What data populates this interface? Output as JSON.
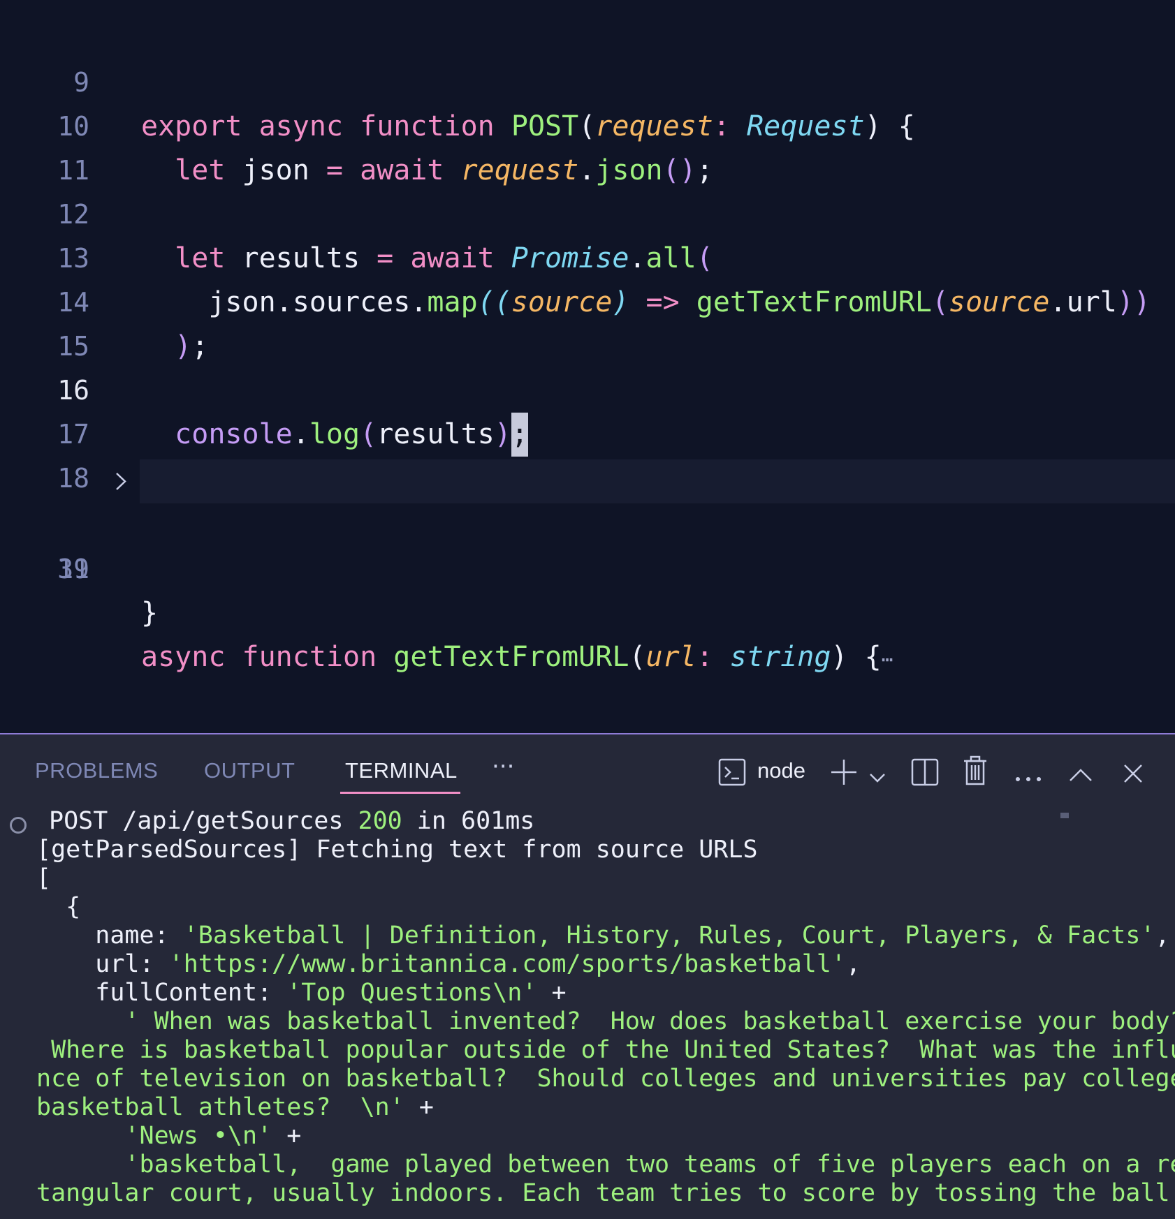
{
  "editor": {
    "lines": [
      {
        "num": "9"
      },
      {
        "num": "10"
      },
      {
        "num": "11"
      },
      {
        "num": "12"
      },
      {
        "num": "13"
      },
      {
        "num": "14"
      },
      {
        "num": "15"
      },
      {
        "num": "16"
      },
      {
        "num": "17"
      },
      {
        "num": "18"
      },
      {
        "num": "19"
      },
      {
        "num": "31"
      }
    ],
    "code": {
      "l9": {
        "export": "export",
        "async": "async",
        "function": "function",
        "name": "POST",
        "p1": "(",
        "param": "request",
        "colon": ": ",
        "type": "Request",
        "p2": ")",
        "brace": " {"
      },
      "l10": {
        "let": "let",
        "var": " json ",
        "eq": "=",
        "await": " await ",
        "obj": "request",
        "dot": ".",
        "method": "json",
        "parens": "()",
        "semi": ";"
      },
      "l12": {
        "let": "let",
        "var": " results ",
        "eq": "=",
        "await": " await ",
        "obj": "Promise",
        "dot": ".",
        "method": "all",
        "paren": "("
      },
      "l13": {
        "a": "json.sources.",
        "map": "map",
        "p1": "((",
        "param": "source",
        "p2": ")",
        "arrow": " => ",
        "fn": "getTextFromURL",
        "p3": "(",
        "param2": "source",
        "b": ".url",
        "p4": "))"
      },
      "l14": {
        "paren": ")",
        "semi": ";"
      },
      "l16": {
        "console": "console",
        "dot": ".",
        "log": "log",
        "p1": "(",
        "arg": "results",
        "p2": ")",
        "semi": ";"
      },
      "l17": {
        "brace": "}"
      },
      "l19": {
        "async": "async",
        "function": " function ",
        "name": "getTextFromURL",
        "p1": "(",
        "param": "url",
        "colon": ": ",
        "type": "string",
        "p2": ")",
        "brace": " {",
        "ellipsis": "⋯"
      },
      "l31": {
        "brace": "}"
      }
    }
  },
  "panel": {
    "tabs": [
      "PROBLEMS",
      "OUTPUT",
      "TERMINAL"
    ],
    "active_tab": "TERMINAL",
    "more": "···",
    "terminal_name": "node",
    "toolbar_icons": [
      "terminal-icon",
      "plus-icon",
      "chevron-down-icon",
      "split-icon",
      "trash-icon",
      "more-icon",
      "chevron-up-icon",
      "close-icon"
    ]
  },
  "terminal": {
    "l1": {
      "a": "POST /api/getSources ",
      "code": "200",
      "b": " in 601ms"
    },
    "l2": "[getParsedSources] Fetching text from source URLS",
    "l3": "[",
    "l4": "  {",
    "l5": {
      "key": "    name: ",
      "val": "'Basketball | Definition, History, Rules, Court, Players, & Facts'",
      "end": ","
    },
    "l6": {
      "key": "    url: ",
      "val": "'https://www.britannica.com/sports/basketball'",
      "end": ","
    },
    "l7": {
      "key": "    fullContent: ",
      "val": "'Top Questions\\n'",
      "end": " +"
    },
    "l8": "      ' When was basketball invented?  How does basketball exercise your body?",
    "l9": " Where is basketball popular outside of the United States?  What was the influe",
    "l10": "nce of television on basketball?  Should colleges and universities pay college",
    "l11": {
      "val": "basketball athletes?  \\n'",
      "end": " +"
    },
    "l12": {
      "val": "      'News •\\n'",
      "end": " +"
    },
    "l13": "      'basketball,  game played between two teams of five players each on a rec",
    "l14": "tangular court, usually indoors. Each team tries to score by tossing the ball t"
  },
  "colors": {
    "editor_bg": "#0f1426",
    "panel_bg": "#252838",
    "keyword": "#f28fc7",
    "function": "#9ef07e",
    "param": "#f5b764",
    "type": "#7fd8f2",
    "string": "#9ef07e"
  }
}
